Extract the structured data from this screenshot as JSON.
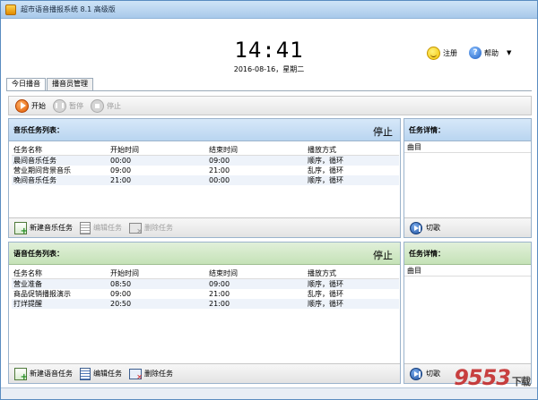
{
  "window": {
    "title": "超市语音播报系统 8.1 高级版"
  },
  "header": {
    "time": "14:41",
    "date": "2016-08-16，星期二",
    "register_label": "注册",
    "help_label": "帮助",
    "menu_arrow": "▼"
  },
  "tabs": [
    {
      "label": "今日播音",
      "active": true
    },
    {
      "label": "播音员管理",
      "active": false
    }
  ],
  "toolbar": {
    "start_label": "开始",
    "pause_label": "暂停",
    "stop_label": "停止"
  },
  "music": {
    "title": "音乐任务列表：",
    "status": "停止",
    "columns": [
      "任务名称",
      "开始时间",
      "结束时间",
      "播放方式"
    ],
    "rows": [
      [
        "晨间音乐任务",
        "00:00",
        "09:00",
        "顺序，循环"
      ],
      [
        "营业期间背景音乐",
        "09:00",
        "21:00",
        "乱序，循环"
      ],
      [
        "晚间音乐任务",
        "21:00",
        "00:00",
        "顺序，循环"
      ]
    ],
    "new_label": "新建音乐任务",
    "edit_label": "编辑任务",
    "delete_label": "删除任务"
  },
  "music_detail": {
    "title": "任务详情：",
    "column": "曲目",
    "skip_label": "切歌"
  },
  "voice": {
    "title": "语音任务列表：",
    "status": "停止",
    "columns": [
      "任务名称",
      "开始时间",
      "结束时间",
      "播放方式"
    ],
    "rows": [
      [
        "营业准备",
        "08:50",
        "09:00",
        "顺序，循环"
      ],
      [
        "商品促销播报演示",
        "09:00",
        "21:00",
        "乱序，循环"
      ],
      [
        "打烊提醒",
        "20:50",
        "21:00",
        "顺序，循环"
      ]
    ],
    "new_label": "新建语音任务",
    "edit_label": "编辑任务",
    "delete_label": "删除任务"
  },
  "voice_detail": {
    "title": "任务详情：",
    "column": "曲目",
    "skip_label": "切歌"
  },
  "watermark": {
    "brand": "9553",
    "suffix": "下载"
  }
}
